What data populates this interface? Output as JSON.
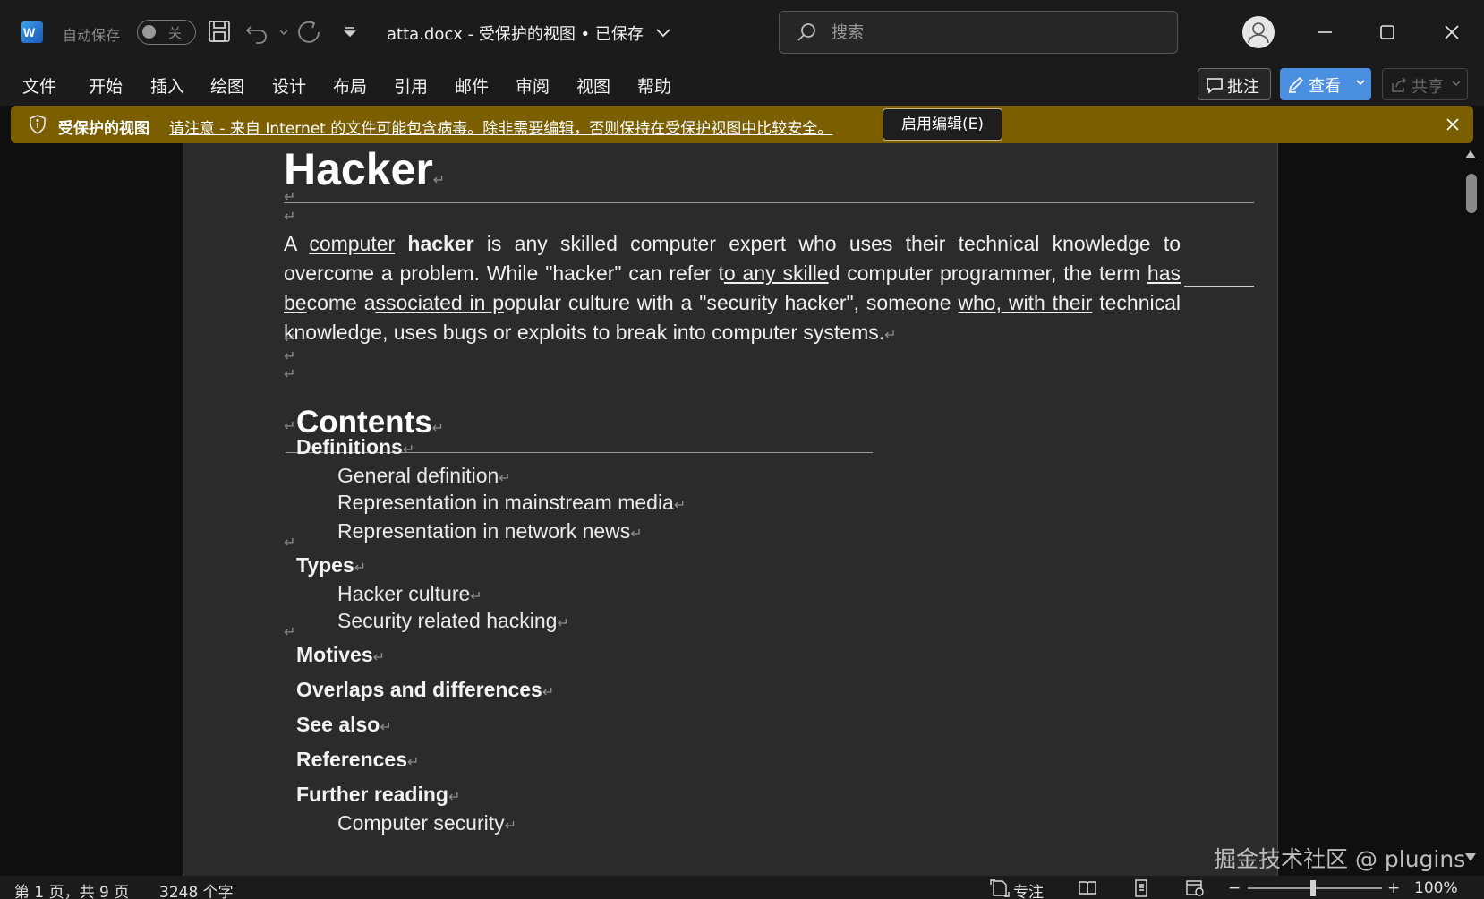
{
  "titlebar": {
    "autosave_label": "自动保存",
    "autosave_state": "关",
    "doc_title": "atta.docx  -  受保护的视图 • 已保存",
    "search_placeholder": "搜索"
  },
  "menu": {
    "items": [
      "文件",
      "开始",
      "插入",
      "绘图",
      "设计",
      "布局",
      "引用",
      "邮件",
      "审阅",
      "视图",
      "帮助"
    ],
    "comment_label": "批注",
    "view_label": "查看",
    "share_label": "共享"
  },
  "protected_view": {
    "title": "受保护的视图",
    "message": "请注意 - 来自 Internet 的文件可能包含病毒。除非需要编辑，否则保持在受保护视图中比较安全。",
    "enable_button": "启用编辑(E)",
    "bar_color": "#7a5e00"
  },
  "document": {
    "heading": "Hacker",
    "intro": {
      "a": "A ",
      "computer": "computer",
      "hacker": "hacker",
      "s1": " is any skilled computer expert who uses their technical knowledge to overcome a problem. While \"hacker\" can refer t",
      "u2": "o any skille",
      "s2": "d computer programmer, the term ",
      "u3": "has be",
      "s3": "come a",
      "u4": "ssociated in p",
      "s4": "opular culture with a \"security hacker\", someone ",
      "u5": "who, with their",
      "s5": " technical knowledge, uses bugs or exploits to break into computer systems."
    },
    "toc_title": "Contents",
    "toc": {
      "definitions": "Definitions",
      "general_definition": "General definition",
      "mainstream_media": "Representation in mainstream media",
      "network_news": "Representation in network news",
      "types": "Types",
      "hacker_culture": "Hacker culture",
      "security_hacking": "Security related hacking",
      "motives": "Motives",
      "overlaps": "Overlaps and differences",
      "see_also": "See also",
      "references": "References",
      "further_reading": "Further reading",
      "computer_security": "Computer security"
    },
    "para_mark": "↵"
  },
  "watermark": "掘金技术社区 @ plugins",
  "statusbar": {
    "page_info": "第 1 页，共 9 页",
    "word_count": "3248 个字",
    "focus_label": "专注",
    "zoom": "100%"
  },
  "colors": {
    "page_bg": "#2b2b2b",
    "chrome_bg": "#1b1b1b",
    "accent": "#4a8fe0",
    "word_blue": "#185abd"
  }
}
